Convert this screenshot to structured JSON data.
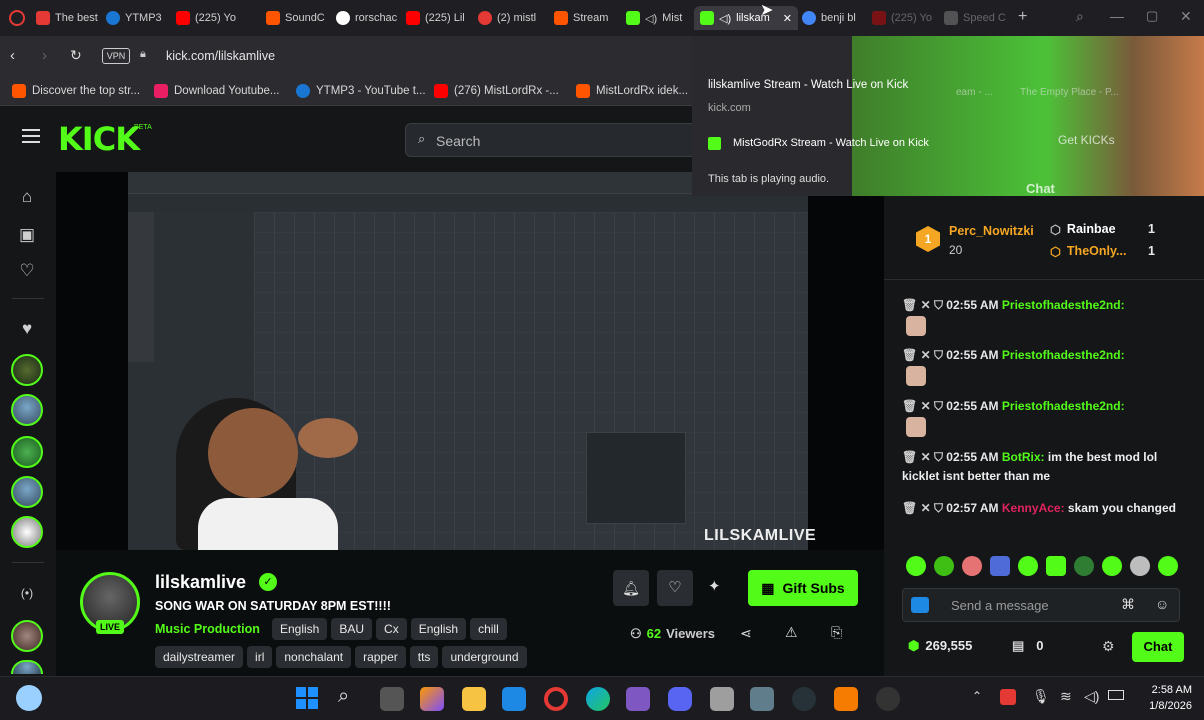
{
  "browser": {
    "tabs": [
      {
        "label": "The best",
        "color": "#e53935"
      },
      {
        "label": "YTMP3",
        "color": "#1976d2"
      },
      {
        "label": "(225) Yo",
        "color": "#ff0000"
      },
      {
        "label": "SoundC",
        "color": "#ff5500"
      },
      {
        "label": "rorschac",
        "color": "#4285f4"
      },
      {
        "label": "(225) Lil",
        "color": "#ff0000"
      },
      {
        "label": "(2) mistl",
        "color": "#e53935"
      },
      {
        "label": "Stream",
        "color": "#ff5500"
      },
      {
        "label": "Mist",
        "color": "#53fc18"
      },
      {
        "label": "lilskam",
        "color": "#53fc18"
      },
      {
        "label": "benji bl",
        "color": "#4285f4"
      },
      {
        "label": "(225) Yo",
        "color": "#ff0000"
      },
      {
        "label": "Speed C",
        "color": "#9e9e9e"
      }
    ],
    "vpn_label": "VPN",
    "url": "kick.com/lilskamlive",
    "bookmarks": [
      {
        "label": "Discover the top str...",
        "color": "#ff5500"
      },
      {
        "label": "Download Youtube...",
        "color": "#e91e63"
      },
      {
        "label": "YTMP3 - YouTube t...",
        "color": "#1976d2"
      },
      {
        "label": "(276) MistLordRx -...",
        "color": "#ff0000"
      },
      {
        "label": "MistLordRx idek...",
        "color": "#ff5500"
      }
    ],
    "popup": {
      "title": "lilskamlive Stream - Watch Live on Kick",
      "domain": "kick.com",
      "tab2": "MistGodRx Stream - Watch Live on Kick",
      "audio": "This tab is playing audio."
    }
  },
  "kick": {
    "logo": "KICK",
    "logo_badge": "BETA",
    "search_placeholder": "Search",
    "video_watermark": "LILSKAMLIVE",
    "overlay": {
      "get_kicks": "Get KICKs",
      "chat": "Chat",
      "bookmark_a": "eam - ...",
      "bookmark_b": "The Empty Place - P..."
    },
    "stream": {
      "channel": "lilskamlive",
      "live": "LIVE",
      "title": "SONG WAR ON SATURDAY 8PM EST!!!!",
      "category": "Music Production",
      "tags_row1": [
        "English",
        "BAU",
        "Cx",
        "English",
        "chill"
      ],
      "tags_row2": [
        "dailystreamer",
        "irl",
        "nonchalant",
        "rapper",
        "tts",
        "underground"
      ],
      "gift_subs": "Gift Subs",
      "viewers": "62",
      "viewers_label": "Viewers"
    },
    "chat": {
      "top_gifter": {
        "rank": "1",
        "name": "Perc_Nowitzki",
        "count": "20"
      },
      "leaders": [
        {
          "name": "Rainbae",
          "count": "1"
        },
        {
          "name": "TheOnly...",
          "count": "1"
        }
      ],
      "messages": [
        {
          "time": "02:55 AM",
          "user": "Priestofhadesthe2nd:",
          "text": "",
          "user_color": "#53fc18"
        },
        {
          "time": "02:55 AM",
          "user": "Priestofhadesthe2nd:",
          "text": "",
          "user_color": "#53fc18"
        },
        {
          "time": "02:55 AM",
          "user": "Priestofhadesthe2nd:",
          "text": "",
          "user_color": "#53fc18"
        },
        {
          "time": "02:55 AM",
          "user": "BotRix:",
          "text": "im the best mod lol kicklet isnt better than me",
          "user_color": "#53fc18"
        },
        {
          "time": "02:57 AM",
          "user": "KennyAce:",
          "text": "skam you changed",
          "user_color": "#e0245e"
        }
      ],
      "input_placeholder": "Send a message",
      "balance": "269,555",
      "slots": "0",
      "send_label": "Chat"
    }
  },
  "taskbar": {
    "time": "2:58 AM",
    "date": "1/8/2026"
  },
  "colors": {
    "kick_green": "#53fc18",
    "bg": "#0b0e0f",
    "panel": "#141618"
  }
}
